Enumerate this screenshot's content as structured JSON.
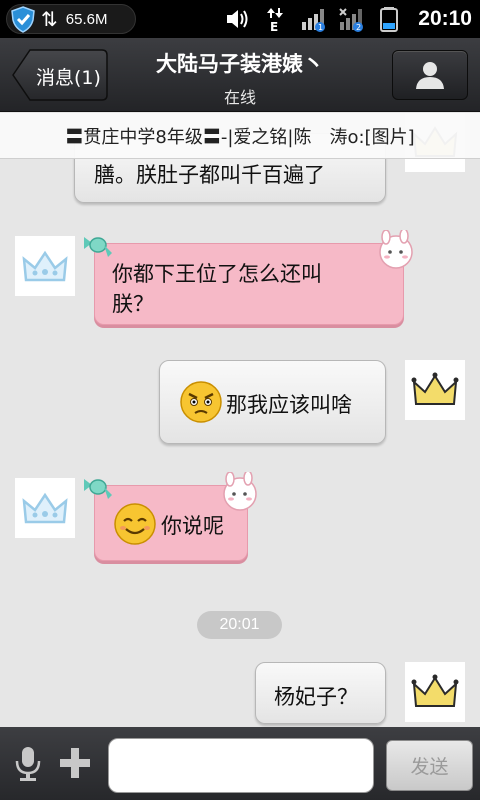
{
  "status_bar": {
    "memory": "65.6M",
    "time": "20:10",
    "sim1_badge": "1",
    "sim2_badge": "2",
    "data_type": "E"
  },
  "header": {
    "back_label": "消息(1)",
    "title": "大陆马子装港婊丶",
    "subtitle": "在线"
  },
  "group_banner": {
    "text": "〓贯庄中学8年级〓-|爱之铭|陈　涛o:[图片]"
  },
  "messages": [
    {
      "side": "right",
      "style": "gray",
      "text": "膳。朕肚子都叫千百遍了"
    },
    {
      "side": "left",
      "style": "pink",
      "lines": [
        "你都下王位了怎么还叫",
        "朕？"
      ]
    },
    {
      "side": "right",
      "style": "gray",
      "emoji": "angry-face",
      "text": "那我应该叫啥"
    },
    {
      "side": "left",
      "style": "pink",
      "emoji": "smile-face",
      "text": "你说呢"
    },
    {
      "side": "right",
      "style": "gray",
      "text": "杨妃子？"
    }
  ],
  "timestamp": "20:01",
  "input_bar": {
    "placeholder": "",
    "send_label": "发送"
  },
  "colors": {
    "pink_bubble": "#f6b9c7",
    "gray_bubble": "#eeeeee",
    "header_bg": "#2e2f33",
    "crown_gold": "#e9c94a",
    "crown_blue": "#a8d4ee"
  },
  "icons": [
    "shield-icon",
    "sync-icon",
    "volume-icon",
    "data-arrows-icon",
    "signal-icon",
    "battery-icon",
    "back-arrow-icon",
    "profile-icon",
    "mic-icon",
    "plus-icon",
    "gold-crown-icon",
    "blue-crown-icon",
    "rabbit-sticker-icon",
    "candy-sticker-icon"
  ]
}
